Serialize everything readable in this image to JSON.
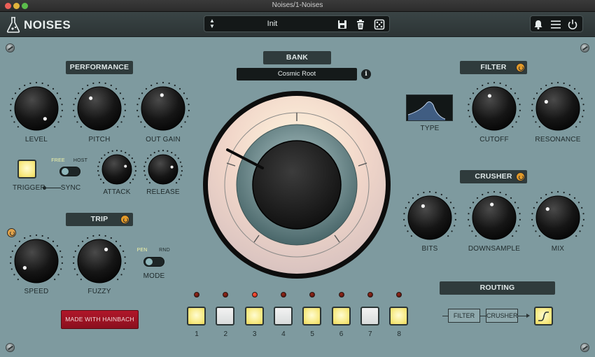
{
  "window": {
    "title": "Noises/1-Noises"
  },
  "header": {
    "logo_text": "NOISES",
    "preset_name": "Init",
    "icons": [
      "up-down-arrows-icon",
      "save-icon",
      "trash-icon",
      "dice-icon",
      "bell-icon",
      "menu-icon",
      "power-icon"
    ]
  },
  "performance": {
    "title": "PERFORMANCE",
    "knobs": {
      "level": "LEVEL",
      "pitch": "PITCH",
      "out_gain": "OUT GAIN",
      "attack": "ATTACK",
      "release": "RELEASE"
    },
    "trigger_label": "TRIGGER",
    "sync_label": "SYNC",
    "sync_options": {
      "free": "FREE",
      "host": "HOST"
    }
  },
  "trip": {
    "title": "TRIP",
    "knobs": {
      "speed": "SPEED",
      "fuzzy": "FUZZY"
    },
    "mode_label": "MODE",
    "mode_options": {
      "pen": "PEN",
      "rnd": "RND"
    }
  },
  "bank": {
    "title": "BANK",
    "value": "Cosmic Root",
    "info": "i"
  },
  "filter": {
    "title": "FILTER",
    "type_label": "TYPE",
    "knobs": {
      "cutoff": "CUTOFF",
      "resonance": "RESONANCE"
    }
  },
  "crusher": {
    "title": "CRUSHER",
    "knobs": {
      "bits": "BITS",
      "downsample": "DOWNSAMPLE",
      "mix": "MIX"
    }
  },
  "routing": {
    "title": "ROUTING",
    "boxes": [
      "FILTER",
      "CRUSHER"
    ]
  },
  "steps": {
    "numbers": [
      "1",
      "2",
      "3",
      "4",
      "5",
      "6",
      "7",
      "8"
    ],
    "active_led": 3
  },
  "made_with": "MADE WITH HAINBACH",
  "colors": {
    "panel": "#7e9a9f",
    "label_bg": "#2f3b3c",
    "accent": "#e29a2a",
    "brand_red": "#9b1324",
    "pad_yellow": "#f6e77a"
  }
}
